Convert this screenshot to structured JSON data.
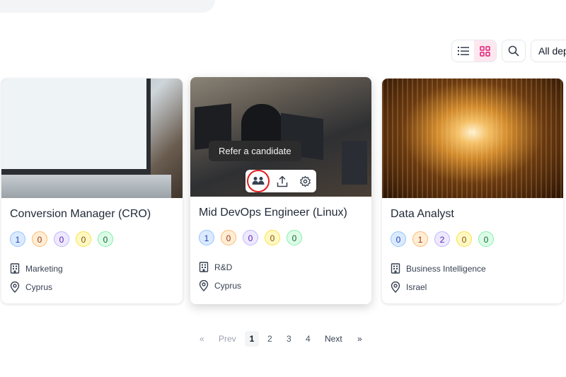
{
  "toolbar": {
    "department_select": "All dep"
  },
  "colors": {
    "accent": "#e11d74",
    "stage_blue": "#dbeafe",
    "stage_orange": "#ffedd5",
    "stage_purple": "#ede9fe",
    "stage_yellow": "#fef9c3",
    "stage_green": "#dcfce7",
    "highlight_ring": "#e11d1d"
  },
  "cards": [
    {
      "title": "Conversion Manager (CRO)",
      "stages": [
        "1",
        "0",
        "0",
        "0",
        "0"
      ],
      "department": "Marketing",
      "location": "Cyprus",
      "image": "laptop-analytics-photo"
    },
    {
      "title": "Mid DevOps Engineer (Linux)",
      "stages": [
        "1",
        "0",
        "0",
        "0",
        "0"
      ],
      "department": "R&D",
      "location": "Cyprus",
      "image": "office-workers-photo",
      "tooltip": "Refer a candidate",
      "actions": [
        "refer-candidate-icon",
        "share-icon",
        "settings-icon"
      ]
    },
    {
      "title": "Data Analyst",
      "stages": [
        "0",
        "1",
        "2",
        "0",
        "0"
      ],
      "department": "Business Intelligence",
      "location": "Israel",
      "image": "light-tunnel-photo"
    }
  ],
  "pagination": {
    "first": "«",
    "prev": "Prev",
    "pages": [
      "1",
      "2",
      "3",
      "4"
    ],
    "current": "1",
    "next": "Next",
    "last": "»"
  }
}
